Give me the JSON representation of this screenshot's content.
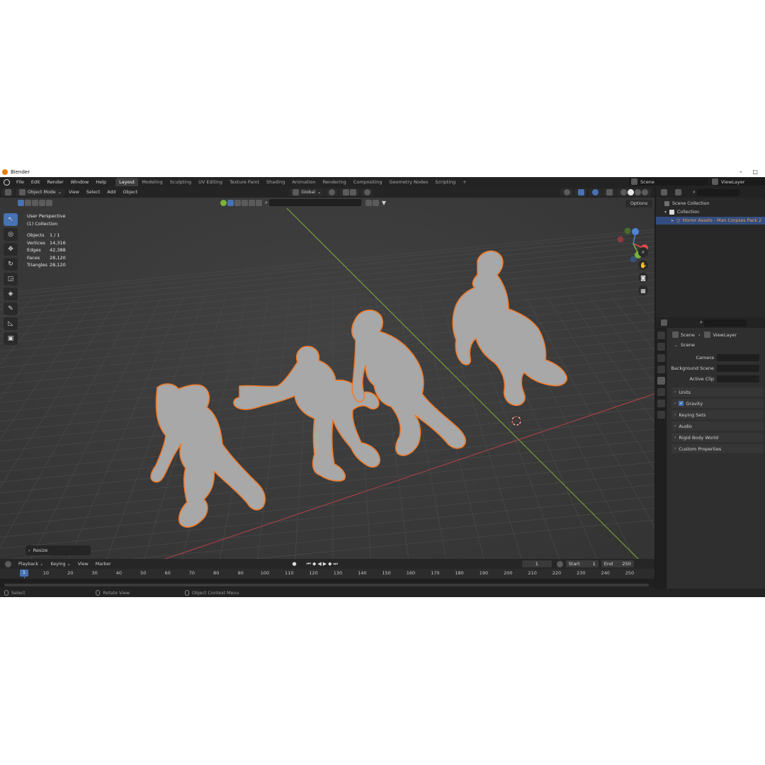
{
  "window": {
    "title": "Blender",
    "controls": "–  ▢"
  },
  "menu": [
    "File",
    "Edit",
    "Render",
    "Window",
    "Help"
  ],
  "workspaces": [
    "Layout",
    "Modeling",
    "Sculpting",
    "UV Editing",
    "Texture Paint",
    "Shading",
    "Animation",
    "Rendering",
    "Compositing",
    "Geometry Nodes",
    "Scripting",
    "+"
  ],
  "scene_selector": "Scene",
  "viewlayer_selector": "ViewLayer",
  "viewport_header": {
    "mode": "Object Mode",
    "menus": [
      "View",
      "Select",
      "Add",
      "Object"
    ],
    "transform": "Global",
    "options": "Options"
  },
  "viewport_info": {
    "perspective": "User Perspective",
    "collection": "(1) Collection"
  },
  "stats": [
    {
      "label": "Objects",
      "value": "1 / 1"
    },
    {
      "label": "Vertices",
      "value": "14,316"
    },
    {
      "label": "Edges",
      "value": "42,388"
    },
    {
      "label": "Faces",
      "value": "28,120"
    },
    {
      "label": "Triangles",
      "value": "28,120"
    }
  ],
  "last_operator": "Resize",
  "timeline": {
    "menus": [
      "Playback",
      "Keying",
      "View",
      "Marker"
    ],
    "current_frame": "1",
    "start_label": "Start",
    "start": "1",
    "end_label": "End",
    "end": "250",
    "ticks": [
      "1",
      "10",
      "20",
      "30",
      "40",
      "50",
      "60",
      "70",
      "80",
      "90",
      "100",
      "110",
      "120",
      "130",
      "140",
      "150",
      "160",
      "170",
      "180",
      "190",
      "200",
      "210",
      "220",
      "230",
      "240",
      "250"
    ]
  },
  "statusbar": [
    "Select",
    "Rotate View",
    "Object Context Menu"
  ],
  "outliner": {
    "root": "Scene Collection",
    "collection": "Collection",
    "object": "Horror Assets - Man Corpses Pack 2"
  },
  "properties": {
    "breadcrumb_scene": "Scene",
    "breadcrumb_layer": "ViewLayer",
    "section": "Scene",
    "fields": [
      "Camera",
      "Background Scene",
      "Active Clip"
    ],
    "subsections": [
      "Units",
      "Gravity",
      "Keying Sets",
      "Audio",
      "Rigid Body World",
      "Custom Properties"
    ],
    "gravity_checked": "✓"
  },
  "icons": {
    "axis_x": "#e5484d",
    "axis_y": "#7ab23a",
    "axis_z": "#4f84d6",
    "selection_outline": "#f07a2a",
    "active_blue": "#4772b3"
  }
}
